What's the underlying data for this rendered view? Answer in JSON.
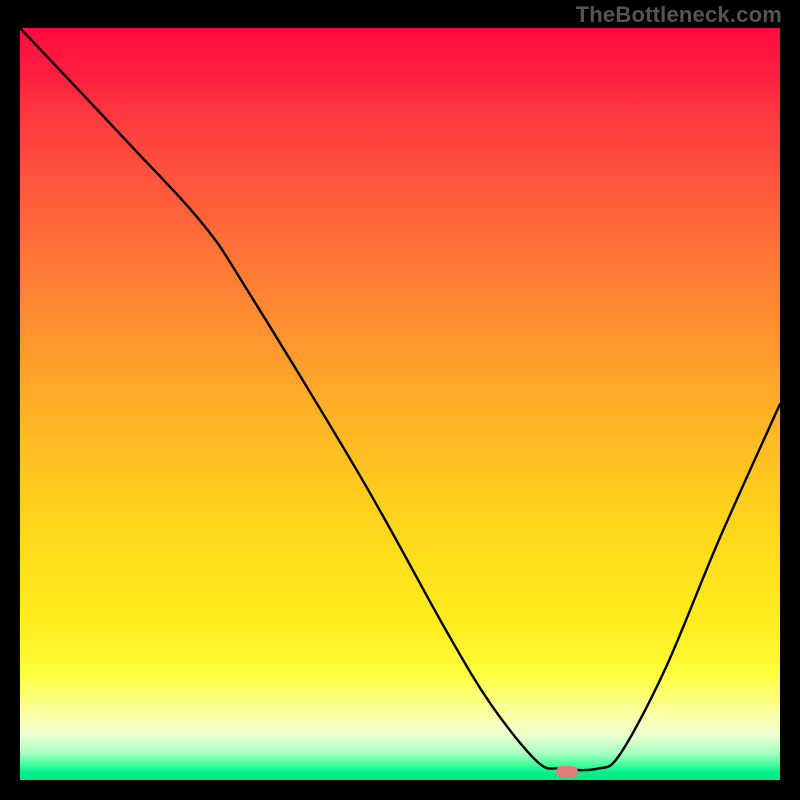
{
  "watermark": "TheBottleneck.com",
  "chart_data": {
    "type": "line",
    "title": "",
    "xlabel": "",
    "ylabel": "",
    "xlim": [
      0,
      100
    ],
    "ylim": [
      0,
      100
    ],
    "background_gradient": {
      "top": "#ff0a3f",
      "middle": "#ffe21a",
      "bottom": "#00e886"
    },
    "series": [
      {
        "name": "curve",
        "x": [
          0,
          14,
          24,
          30,
          45,
          56,
          62,
          68,
          71,
          76,
          79,
          85,
          92,
          100
        ],
        "values": [
          100,
          85,
          74,
          65,
          40,
          20,
          10,
          2.5,
          1.5,
          1.5,
          3.5,
          15,
          32,
          50
        ]
      }
    ],
    "marker": {
      "x": 72,
      "y": 1.0,
      "color": "#e67a7a"
    }
  }
}
